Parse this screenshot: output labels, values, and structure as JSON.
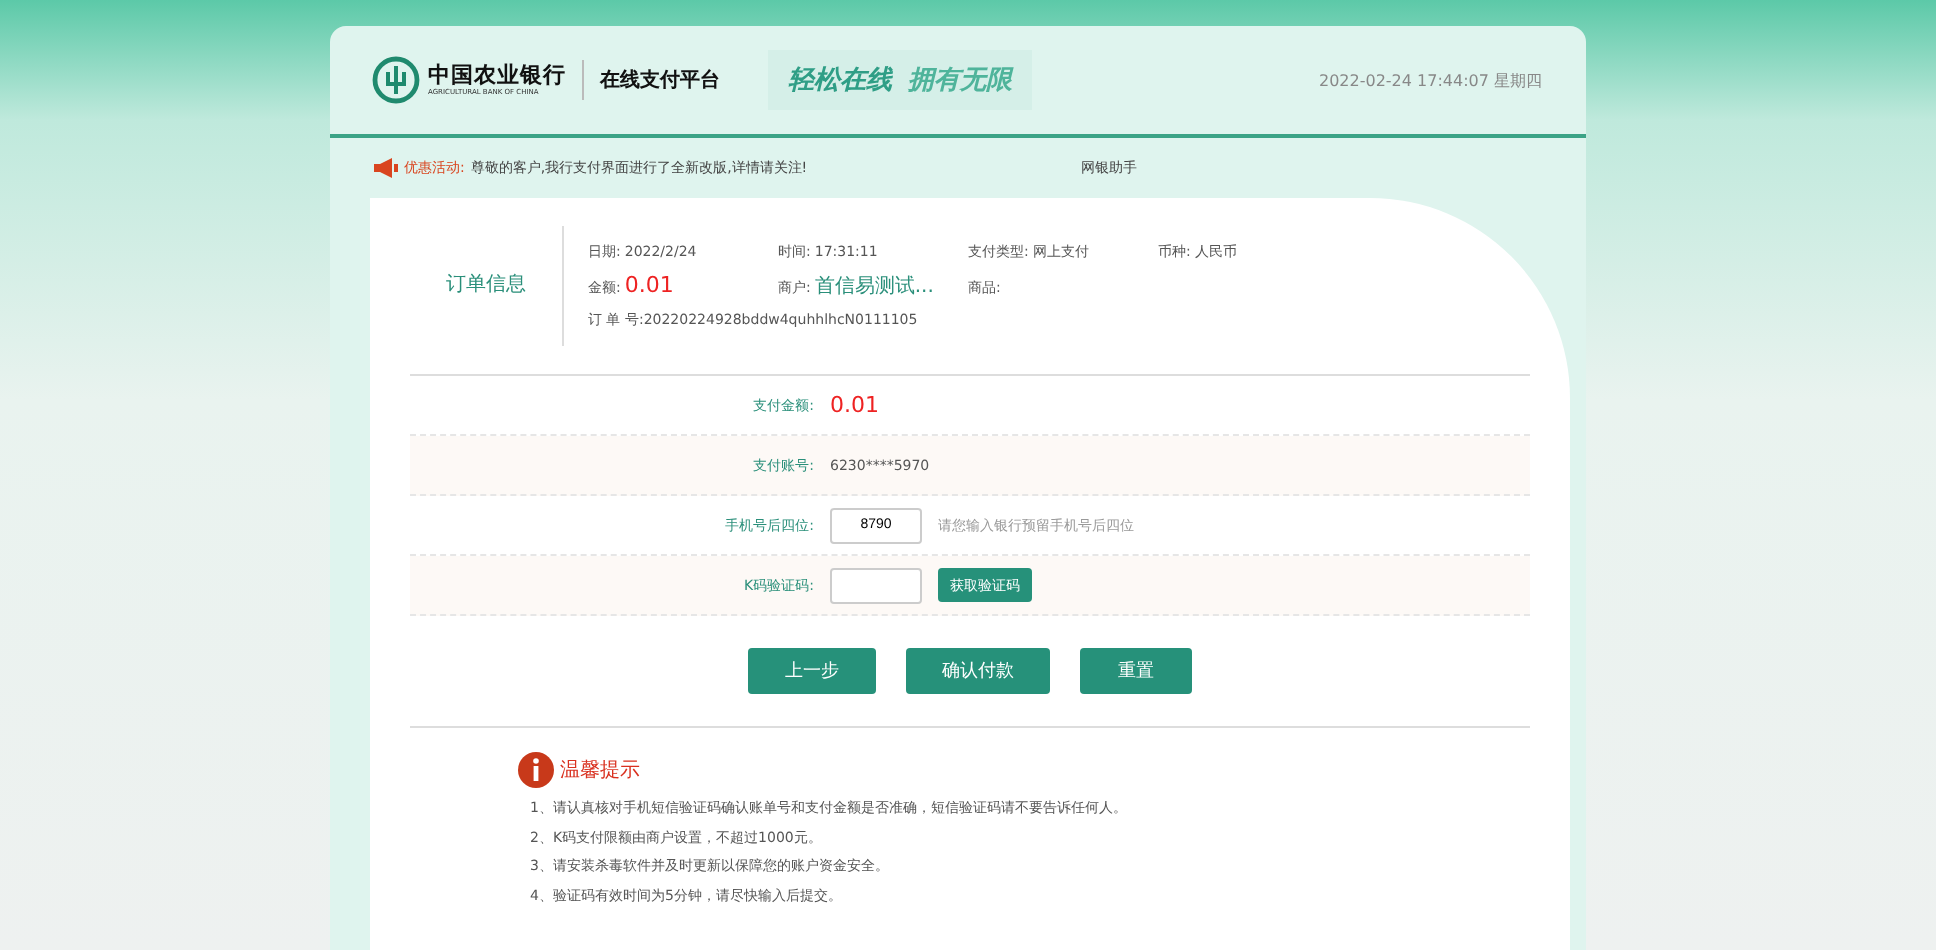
{
  "header": {
    "bank_name": "中国农业银行",
    "bank_name_en": "AGRICULTURAL BANK OF CHINA",
    "platform": "在线支付平台",
    "slogan_a": "轻松在线",
    "slogan_b": "拥有无限",
    "datetime": "2022-02-24 17:44:07 星期四"
  },
  "notice": {
    "label": "优惠活动:",
    "text": "尊敬的客户,我行支付界面进行了全新改版,详情请关注!",
    "link": "网银助手"
  },
  "order": {
    "title": "订单信息",
    "fields": [
      {
        "label": "日期:",
        "value": "2022/2/24",
        "kind": "plain"
      },
      {
        "label": "时间:",
        "value": "17:31:11",
        "kind": "plain"
      },
      {
        "label": "支付类型:",
        "value": "网上支付",
        "kind": "plain"
      },
      {
        "label": "币种:",
        "value": "人民币",
        "kind": "plain"
      },
      {
        "label": "金额:",
        "value": "0.01",
        "kind": "amount"
      },
      {
        "label": "商户:",
        "value": "首信易测试...",
        "kind": "merchant"
      },
      {
        "label": "商品:",
        "kind": "plain"
      }
    ],
    "order_no_label": "订 单 号:",
    "order_no": "20220224928bddw4quhhlhcN0111105"
  },
  "form": [
    {
      "kind": "amount",
      "label": "支付金额:",
      "value": "0.01"
    },
    {
      "kind": "text",
      "label": "支付账号:",
      "value": "6230****5970"
    },
    {
      "kind": "input",
      "label": "手机号后四位:",
      "value": "8790",
      "hint": "请您输入银行预留手机号后四位"
    },
    {
      "kind": "code",
      "label": "K码验证码:",
      "button": "获取验证码"
    }
  ],
  "buttons": [
    "上一步",
    "确认付款",
    "重置"
  ],
  "tips": {
    "title": "温馨提示",
    "items": [
      "1、请认真核对手机短信验证码确认账单号和支付金额是否准确，短信验证码请不要告诉任何人。",
      "2、K码支付限额由商户设置，不超过1000元。",
      "3、请安装杀毒软件并及时更新以保障您的账户资金安全。",
      "4、验证码有效时间为5分钟，请尽快输入后提交。"
    ]
  }
}
